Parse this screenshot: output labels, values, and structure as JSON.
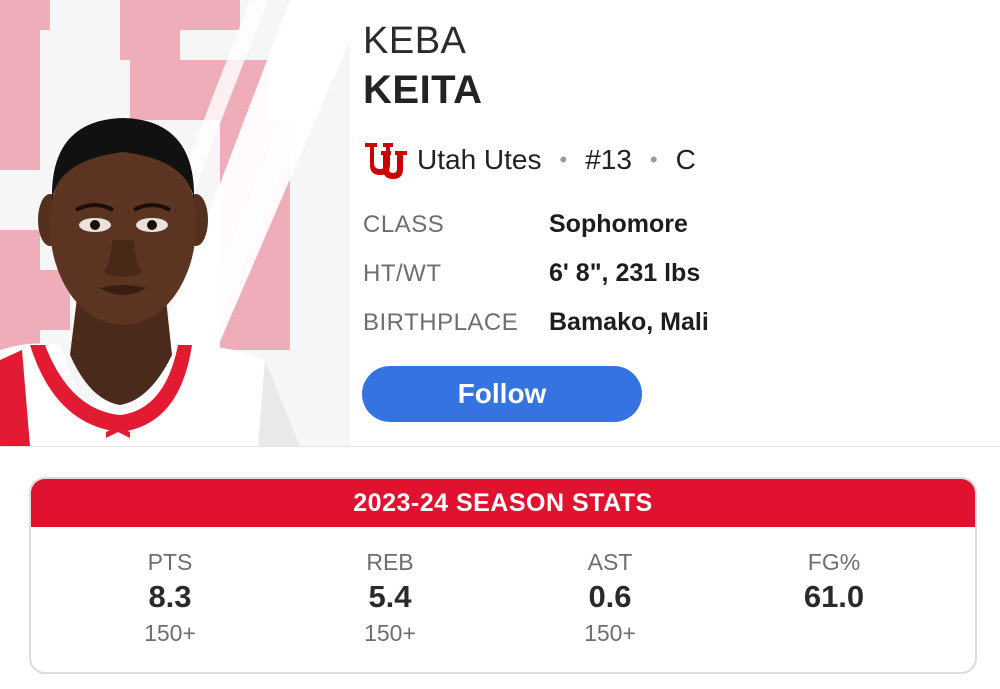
{
  "player": {
    "first_name": "KEBA",
    "last_name": "KEITA",
    "team": "Utah Utes",
    "number": "#13",
    "position": "C",
    "team_logo_icon": "utah-utes-logo-icon",
    "separator": "•"
  },
  "info": [
    {
      "label": "CLASS",
      "value": "Sophomore"
    },
    {
      "label": "HT/WT",
      "value": "6' 8\", 231 lbs"
    },
    {
      "label": "BIRTHPLACE",
      "value": "Bamako, Mali"
    }
  ],
  "follow_label": "Follow",
  "stats": {
    "title": "2023-24 SEASON STATS",
    "items": [
      {
        "label": "PTS",
        "value": "8.3",
        "rank": "150+"
      },
      {
        "label": "REB",
        "value": "5.4",
        "rank": "150+"
      },
      {
        "label": "AST",
        "value": "0.6",
        "rank": "150+"
      },
      {
        "label": "FG%",
        "value": "61.0",
        "rank": ""
      }
    ]
  },
  "colors": {
    "accent_red": "#e0122f",
    "follow_blue": "#3574e0",
    "team_pink": "#f0aab5"
  }
}
